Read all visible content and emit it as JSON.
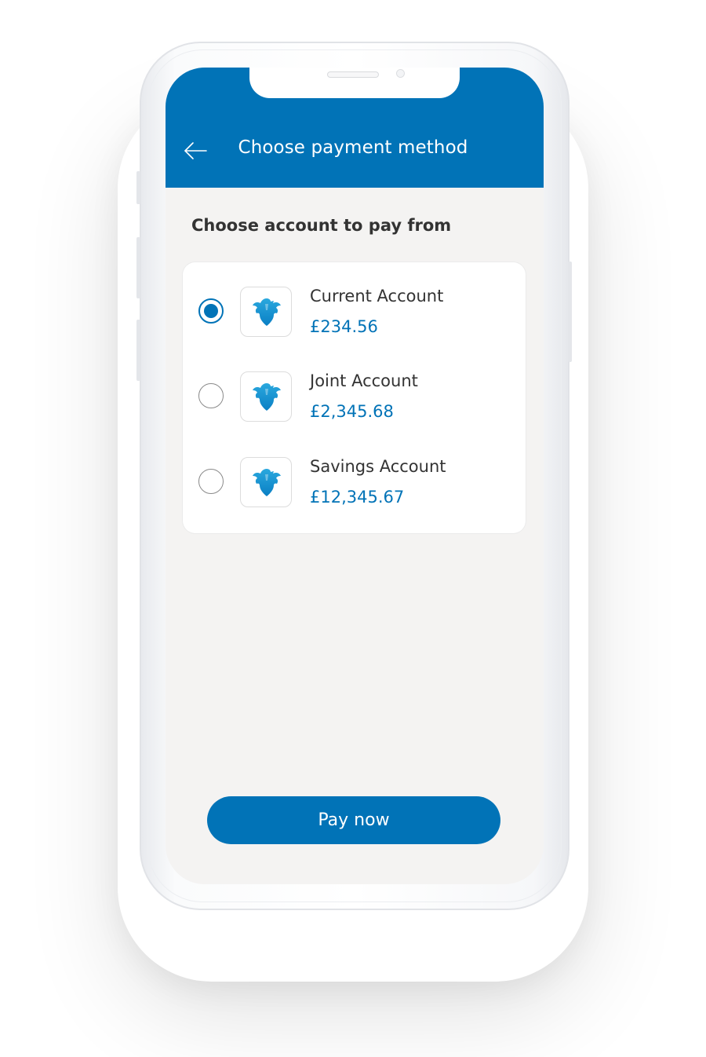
{
  "header": {
    "title": "Choose payment method",
    "background_color": "#0173b7"
  },
  "section": {
    "title": "Choose account to pay from"
  },
  "accounts": [
    {
      "name": "Current Account",
      "balance": "£234.56",
      "selected": true,
      "icon": "eagle-logo-icon"
    },
    {
      "name": "Joint Account",
      "balance": "£2,345.68",
      "selected": false,
      "icon": "eagle-logo-icon"
    },
    {
      "name": "Savings Account",
      "balance": "£12,345.67",
      "selected": false,
      "icon": "eagle-logo-icon"
    }
  ],
  "actions": {
    "pay_label": "Pay now"
  },
  "colors": {
    "accent": "#0173b7",
    "background": "#f4f3f2",
    "card": "#ffffff",
    "text_primary": "#333333"
  }
}
